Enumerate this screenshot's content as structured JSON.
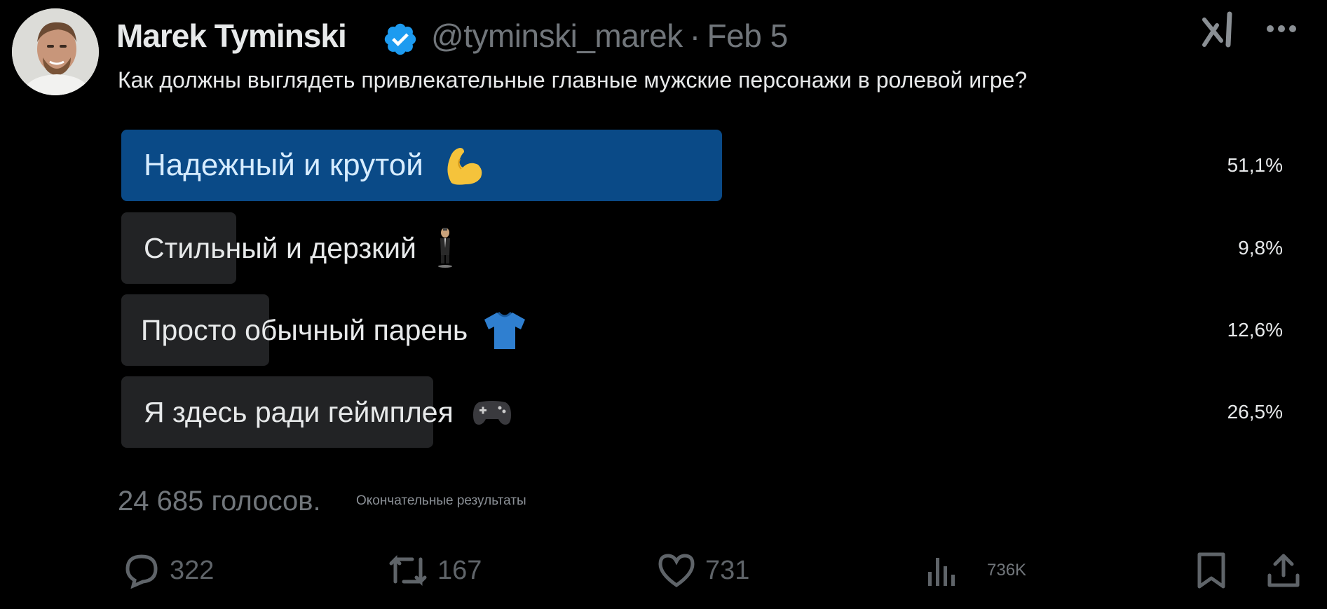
{
  "tweet": {
    "author_name": "Marek Tyminski",
    "handle": "@tyminski_marek",
    "separator": "·",
    "date": "Feb 5",
    "text": "Как должны выглядеть привлекательные главные мужские персонажи в ролевой игре?"
  },
  "poll": {
    "options": [
      {
        "label": "Надежный и крутой",
        "emoji": "flexed-biceps-icon",
        "percent": "51,1%",
        "share": 0.511,
        "winner": true
      },
      {
        "label": "Стильный и дерзкий",
        "emoji": "man-in-suit-levitating-icon",
        "percent": "9,8%",
        "share": 0.098,
        "winner": false
      },
      {
        "label": "Просто обычный парень",
        "emoji": "t-shirt-icon",
        "percent": "12,6%",
        "share": 0.126,
        "winner": false
      },
      {
        "label": "Я здесь ради геймплея",
        "emoji": "video-game-icon",
        "percent": "26,5%",
        "share": 0.265,
        "winner": false
      }
    ],
    "votes": "24 685 голосов.",
    "status": "Окончательные результаты"
  },
  "actions": {
    "replies": "322",
    "reposts": "167",
    "likes": "731",
    "views": "736K"
  },
  "colors": {
    "background": "#000000",
    "winner_bar": "#0a4a87",
    "loser_bar": "#222325",
    "verified": "#1d9bf0",
    "muted_text": "#71767b"
  }
}
